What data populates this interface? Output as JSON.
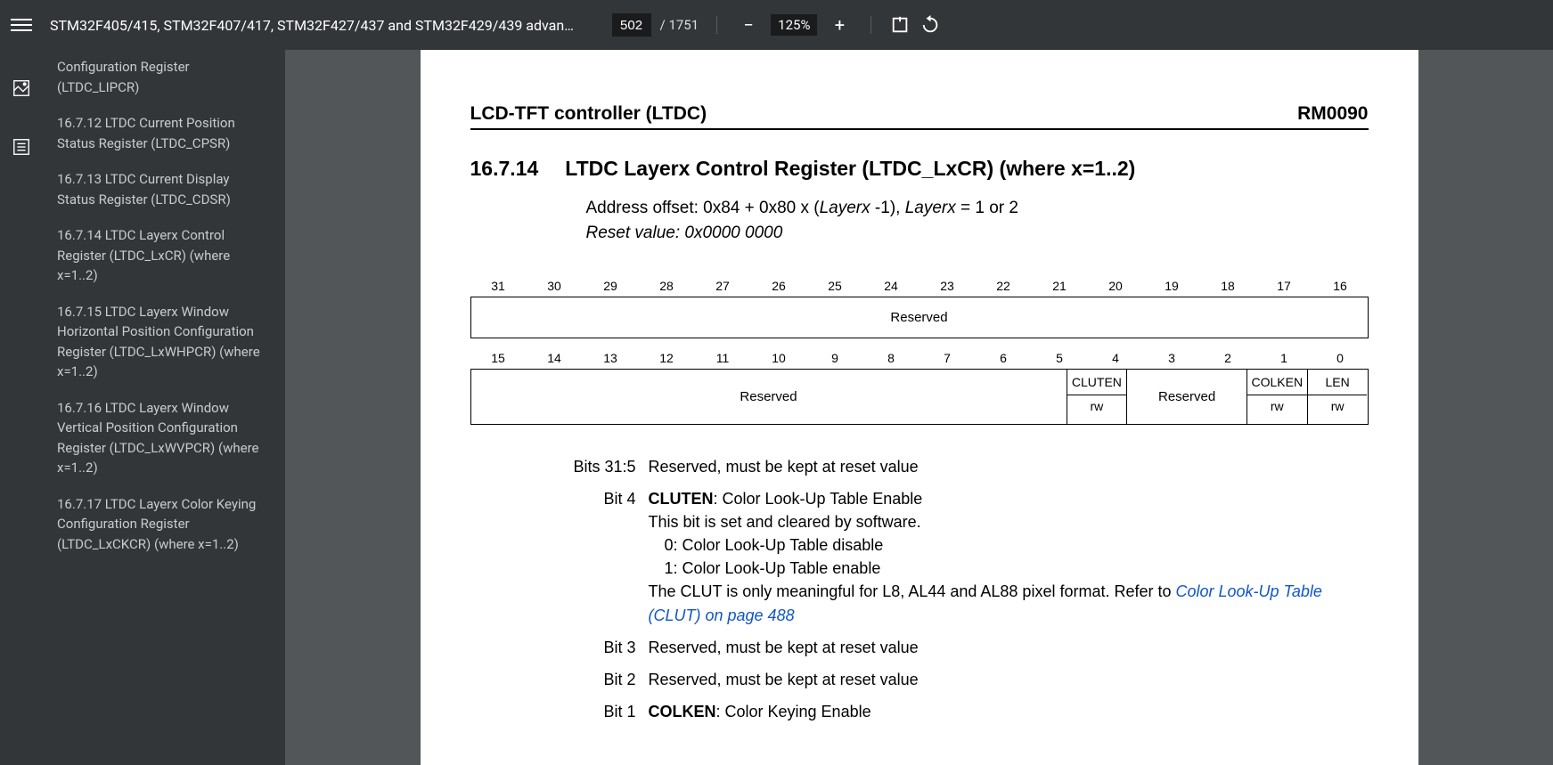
{
  "toolbar": {
    "title": "STM32F405/415, STM32F407/417, STM32F427/437 and STM32F429/439 advan…",
    "page_current": "502",
    "page_total": "/ 1751",
    "zoom": "125%"
  },
  "outline": {
    "items": [
      "Configuration Register (LTDC_LIPCR)",
      "16.7.12 LTDC Current Position Status Register (LTDC_CPSR)",
      "16.7.13 LTDC Current Display Status Register (LTDC_CDSR)",
      "16.7.14 LTDC Layerx Control Register (LTDC_LxCR) (where x=1..2)",
      "16.7.15 LTDC Layerx Window Horizontal Position Configuration Register (LTDC_LxWHPCR) (where x=1..2)",
      "16.7.16 LTDC Layerx Window Vertical Position Configuration Register (LTDC_LxWVPCR) (where x=1..2)",
      "16.7.17 LTDC Layerx Color Keying Configuration Register (LTDC_LxCKCR) (where x=1..2)"
    ]
  },
  "page": {
    "header_left": "LCD-TFT controller (LTDC)",
    "header_right": "RM0090",
    "section_num": "16.7.14",
    "section_title": "LTDC Layerx Control Register (LTDC_LxCR) (where x=1..2)",
    "addr_prefix": "Address offset: 0x84 + 0x80 x (",
    "addr_italic1": "Layerx ",
    "addr_mid": "-1), ",
    "addr_italic2": "Layerx",
    "addr_suffix": " = 1 or 2",
    "reset": "Reset value: 0x0000 0000",
    "bits_high": [
      "31",
      "30",
      "29",
      "28",
      "27",
      "26",
      "25",
      "24",
      "23",
      "22",
      "21",
      "20",
      "19",
      "18",
      "17",
      "16"
    ],
    "reserved_full": "Reserved",
    "bits_low": [
      "15",
      "14",
      "13",
      "12",
      "11",
      "10",
      "9",
      "8",
      "7",
      "6",
      "5",
      "4",
      "3",
      "2",
      "1",
      "0"
    ],
    "row2": {
      "reserved_left": "Reserved",
      "cluten": "CLUTEN",
      "cluten_rw": "rw",
      "reserved_mid": "Reserved",
      "colken": "COLKEN",
      "colken_rw": "rw",
      "len": "LEN",
      "len_rw": "rw"
    },
    "desc": {
      "b31_5_label": "Bits 31:5",
      "b31_5_text": "Reserved, must be kept at reset value",
      "b4_label": "Bit 4",
      "b4_name": "CLUTEN",
      "b4_title": ": Color Look-Up Table Enable",
      "b4_l1": "This bit is set and cleared by software.",
      "b4_l2": "0: Color Look-Up Table disable",
      "b4_l3": "1: Color Look-Up Table enable",
      "b4_l4a": "The CLUT is only meaningful for L8, AL44 and AL88 pixel format. Refer to ",
      "b4_link": "Color Look-Up Table (CLUT) on page 488",
      "b3_label": "Bit 3",
      "b3_text": "Reserved, must be kept at reset value",
      "b2_label": "Bit 2",
      "b2_text": "Reserved, must be kept at reset value",
      "b1_label": "Bit 1",
      "b1_name": "COLKEN",
      "b1_title": ": Color Keying Enable"
    }
  }
}
